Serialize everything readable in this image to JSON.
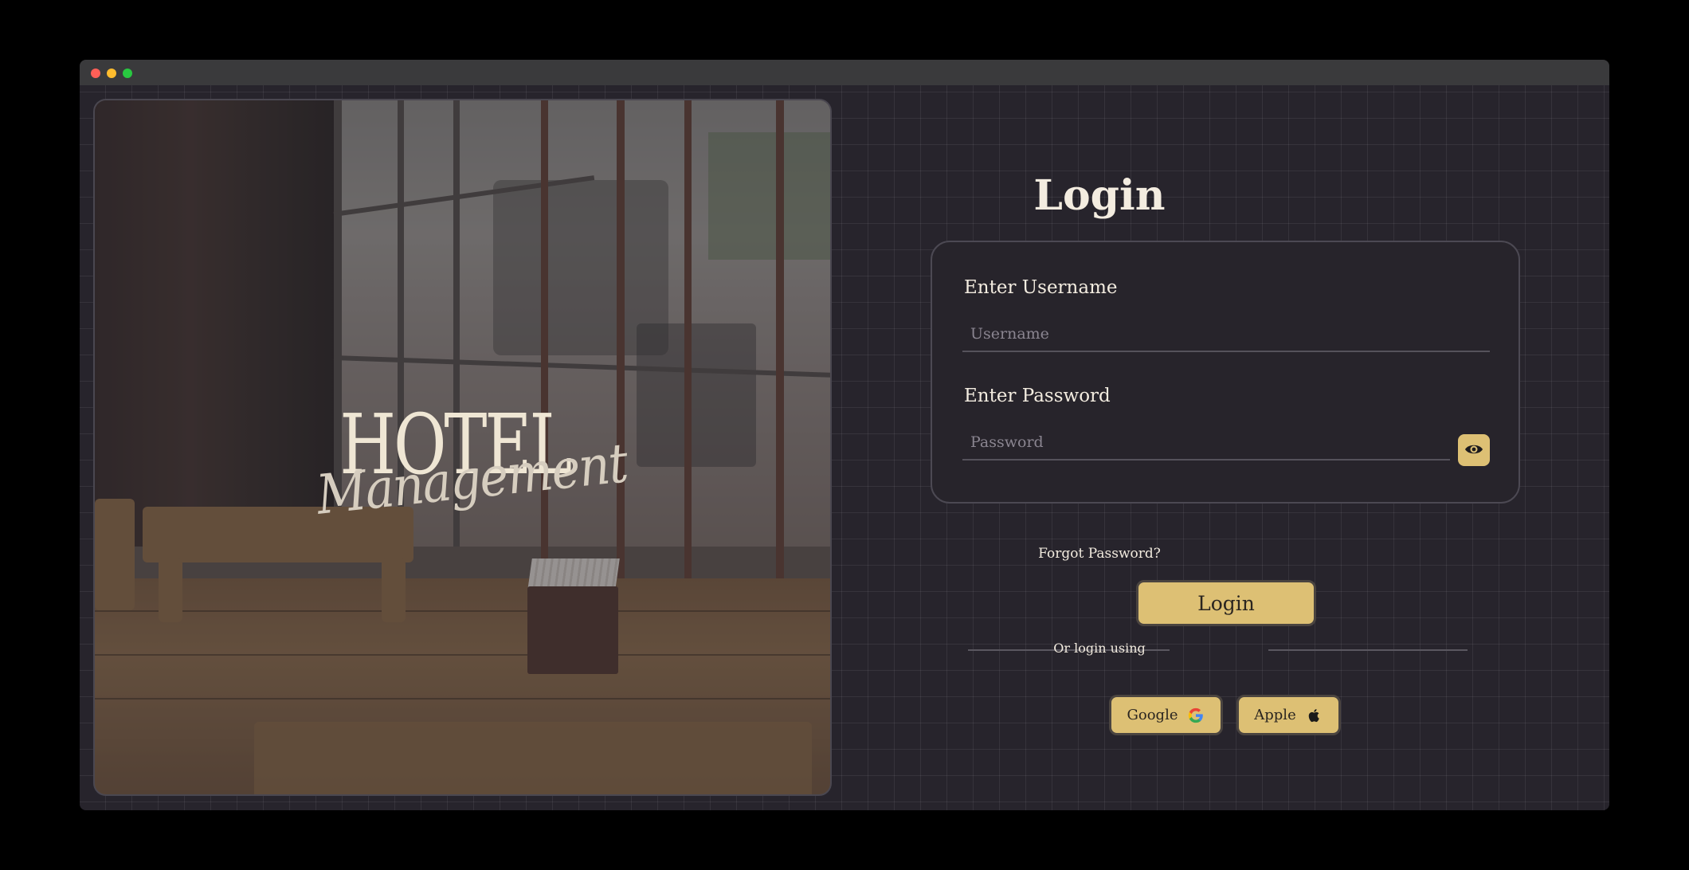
{
  "window": {
    "controls": [
      "close",
      "minimize",
      "maximize"
    ]
  },
  "hero": {
    "brand_line1": "HOTEL",
    "brand_line2": "Management"
  },
  "login": {
    "title": "Login",
    "username_label": "Enter Username",
    "username_placeholder": "Username",
    "username_value": "",
    "password_label": "Enter Password",
    "password_placeholder": "Password",
    "password_value": "",
    "show_password_icon": "eye-icon",
    "forgot_link": "Forgot Password?",
    "submit_label": "Login",
    "divider_text": "Or login using",
    "social": [
      {
        "label": "Google",
        "icon": "google-icon"
      },
      {
        "label": "Apple",
        "icon": "apple-icon"
      }
    ]
  },
  "colors": {
    "accent": "#ddc074",
    "background": "#27242c",
    "text": "#f3ece0"
  }
}
